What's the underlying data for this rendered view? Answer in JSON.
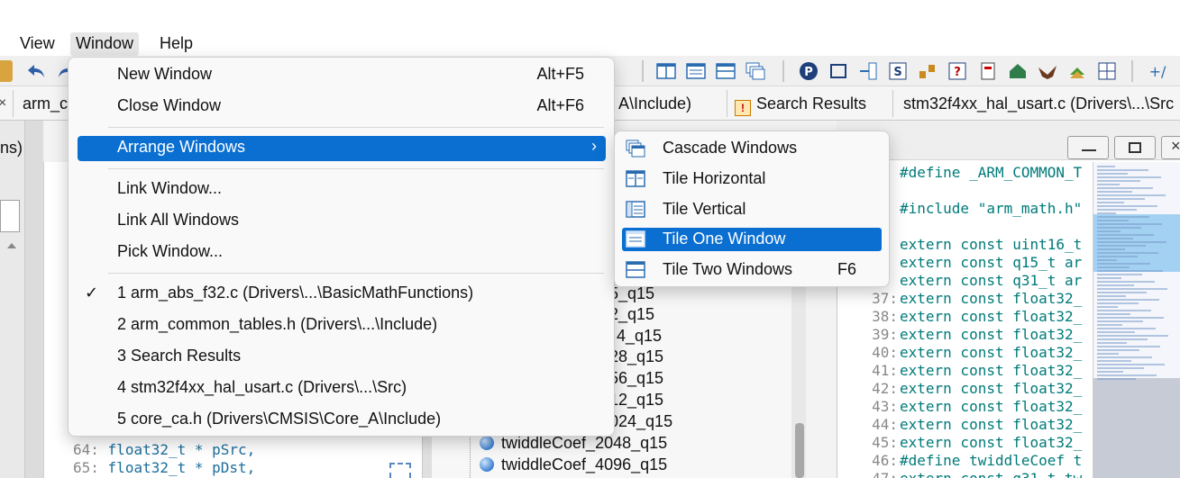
{
  "menubar": {
    "items": [
      "View",
      "Window",
      "Help"
    ]
  },
  "tabs": {
    "items": [
      "arm_c",
      "A\\Include)",
      "Search Results",
      "stm32f4xx_hal_usart.c (Drivers\\...\\Src"
    ]
  },
  "left_pane": {
    "title_fragment": "ns)"
  },
  "left_code": {
    "lines": [
      {
        "num": "64:",
        "text": "float32_t * pSrc,"
      },
      {
        "num": "65:",
        "text": "float32_t * pDst,"
      }
    ]
  },
  "mid_list": {
    "items": [
      "5_q15",
      "2_q15",
      "4_q15",
      "28_q15",
      "56_q15",
      "12_q15",
      "024_q15",
      "twiddleCoef_2048_q15",
      "twiddleCoef_4096_q15"
    ]
  },
  "right_code": {
    "lines": [
      {
        "num": "",
        "text": "#define _ARM_COMMON_T"
      },
      {
        "num": "",
        "text": ""
      },
      {
        "num": "",
        "text": "#include \"arm_math.h\""
      },
      {
        "num": "",
        "text": ""
      },
      {
        "num": "",
        "text": "extern const uint16_t"
      },
      {
        "num": "",
        "text": "extern const q15_t ar"
      },
      {
        "num": "",
        "text": "extern const q31_t ar"
      },
      {
        "num": "37:",
        "text": "extern const float32_"
      },
      {
        "num": "38:",
        "text": "extern const float32_"
      },
      {
        "num": "39:",
        "text": "extern const float32_"
      },
      {
        "num": "40:",
        "text": "extern const float32_"
      },
      {
        "num": "41:",
        "text": "extern const float32_"
      },
      {
        "num": "42:",
        "text": "extern const float32_"
      },
      {
        "num": "43:",
        "text": "extern const float32_"
      },
      {
        "num": "44:",
        "text": "extern const float32_"
      },
      {
        "num": "45:",
        "text": "extern const float32_"
      },
      {
        "num": "46:",
        "text": "#define twiddleCoef t"
      },
      {
        "num": "47:",
        "text": "extern const q31_t tw"
      }
    ]
  },
  "window_menu": {
    "items": [
      {
        "label": "New Window",
        "shortcut": "Alt+F5"
      },
      {
        "label": "Close Window",
        "shortcut": "Alt+F6"
      },
      {
        "label": "Arrange Windows",
        "shortcut": "›"
      },
      {
        "label": "Link Window...",
        "shortcut": ""
      },
      {
        "label": "Link All Windows",
        "shortcut": ""
      },
      {
        "label": "Pick Window...",
        "shortcut": ""
      },
      {
        "label": "1  arm_abs_f32.c (Drivers\\...\\BasicMathFunctions)",
        "shortcut": "",
        "check": "✓"
      },
      {
        "label": "2  arm_common_tables.h (Drivers\\...\\Include)",
        "shortcut": ""
      },
      {
        "label": "3  Search Results",
        "shortcut": ""
      },
      {
        "label": "4  stm32f4xx_hal_usart.c (Drivers\\...\\Src)",
        "shortcut": ""
      },
      {
        "label": "5  core_ca.h (Drivers\\CMSIS\\Core_A\\Include)",
        "shortcut": ""
      }
    ]
  },
  "arrange_submenu": {
    "items": [
      {
        "label": "Cascade Windows",
        "shortcut": "",
        "icon": "cascade-icon"
      },
      {
        "label": "Tile Horizontal",
        "shortcut": "",
        "icon": "tile-horizontal-icon"
      },
      {
        "label": "Tile Vertical",
        "shortcut": "",
        "icon": "tile-vertical-icon"
      },
      {
        "label": "Tile One Window",
        "shortcut": "",
        "icon": "tile-one-icon"
      },
      {
        "label": "Tile Two Windows",
        "shortcut": "F6",
        "icon": "tile-two-icon"
      }
    ]
  },
  "colors": {
    "highlight": "#0a6fd1",
    "keyword_type": "#1c6e9c",
    "keyword_blue": "#0033a0"
  }
}
